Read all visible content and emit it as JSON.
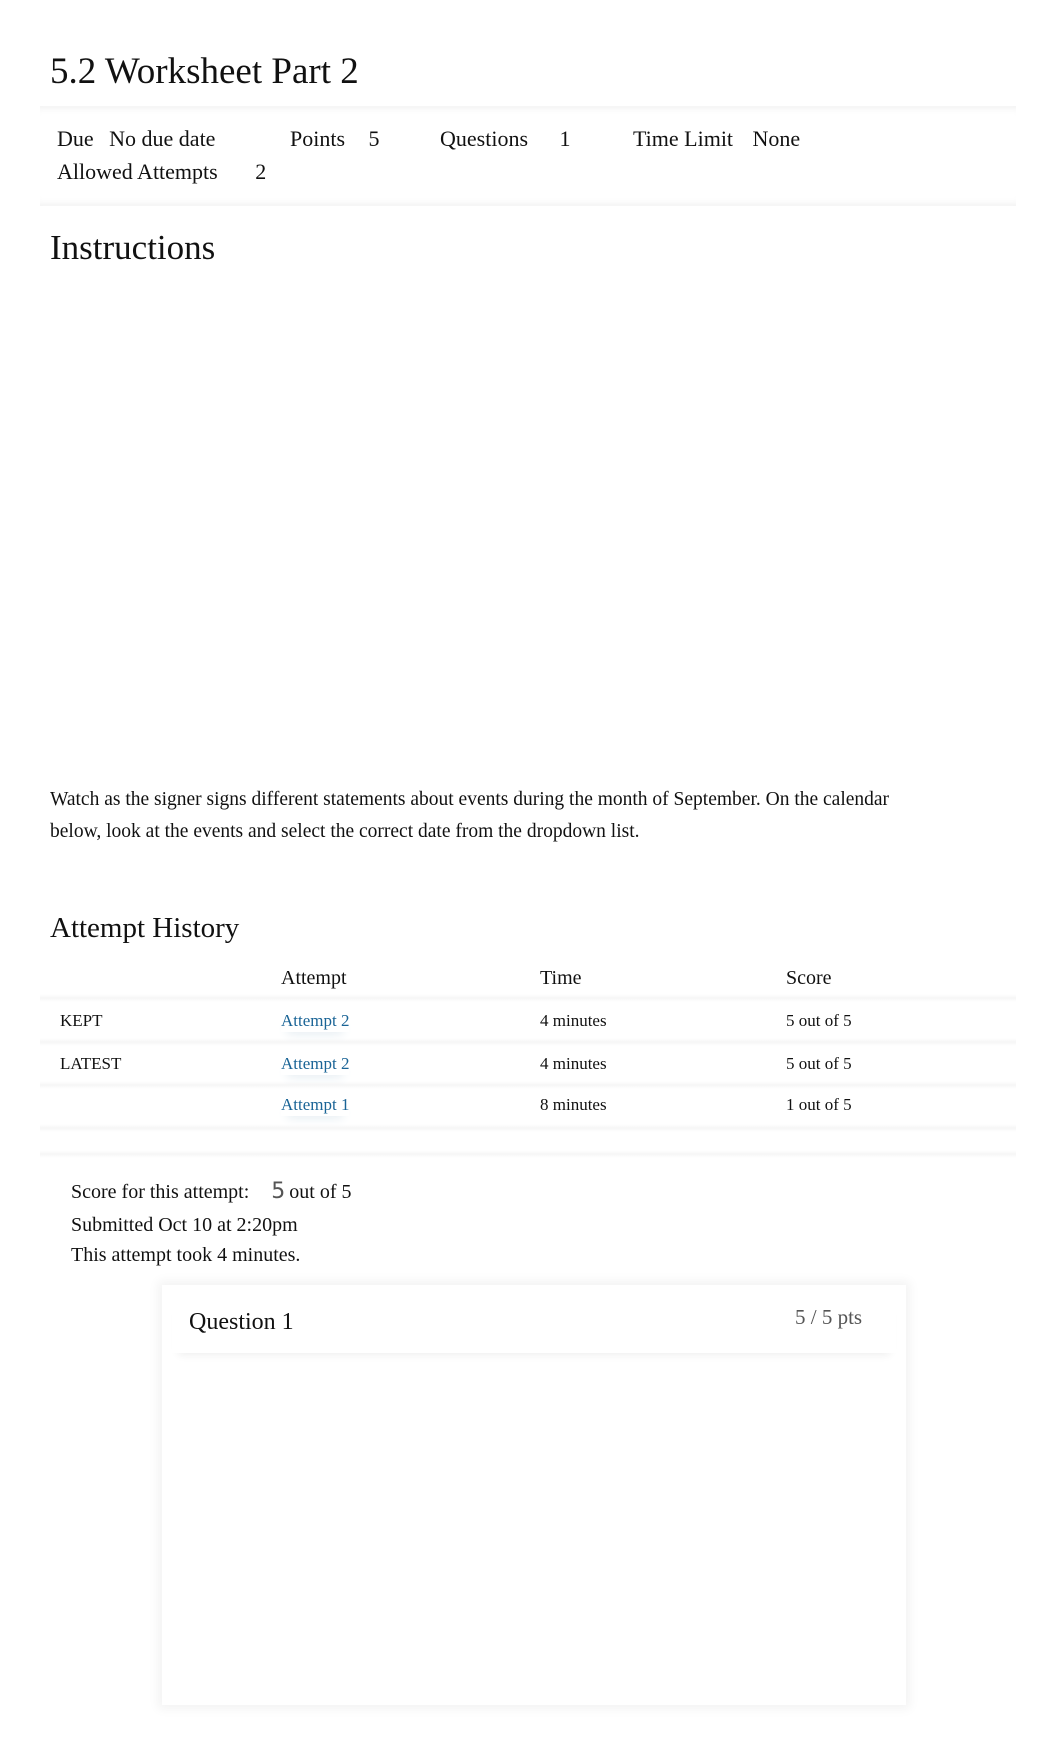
{
  "page": {
    "title": "5.2 Worksheet Part 2"
  },
  "meta": {
    "due_label": "Due",
    "due_value": "No due date",
    "points_label": "Points",
    "points_value": "5",
    "questions_label": "Questions",
    "questions_value": "1",
    "time_limit_label": "Time Limit",
    "time_limit_value": "None",
    "allowed_attempts_label": "Allowed Attempts",
    "allowed_attempts_value": "2"
  },
  "instructions": {
    "heading": "Instructions",
    "text": "Watch as the signer signs different statements about events during the month of September. On the calendar below, look at the events and select the correct date from the dropdown list."
  },
  "attempt_history": {
    "heading": "Attempt History",
    "columns": [
      "",
      "Attempt",
      "Time",
      "Score"
    ],
    "rows": [
      {
        "status": "KEPT",
        "attempt": "Attempt 2",
        "time": "4 minutes",
        "score": "5 out of 5"
      },
      {
        "status": "LATEST",
        "attempt": "Attempt 2",
        "time": "4 minutes",
        "score": "5 out of 5"
      },
      {
        "status": "",
        "attempt": "Attempt 1",
        "time": "8 minutes",
        "score": "1 out of 5"
      }
    ]
  },
  "attempt_summary": {
    "score_label": "Score for this attempt:",
    "score_value": "5",
    "score_suffix": "out of 5",
    "submitted": "Submitted Oct 10 at 2:20pm",
    "duration": "This attempt took 4 minutes."
  },
  "question": {
    "title": "Question 1",
    "points": "5 / 5 pts"
  },
  "colors": {
    "link": "#1a6496",
    "muted": "#555555"
  }
}
